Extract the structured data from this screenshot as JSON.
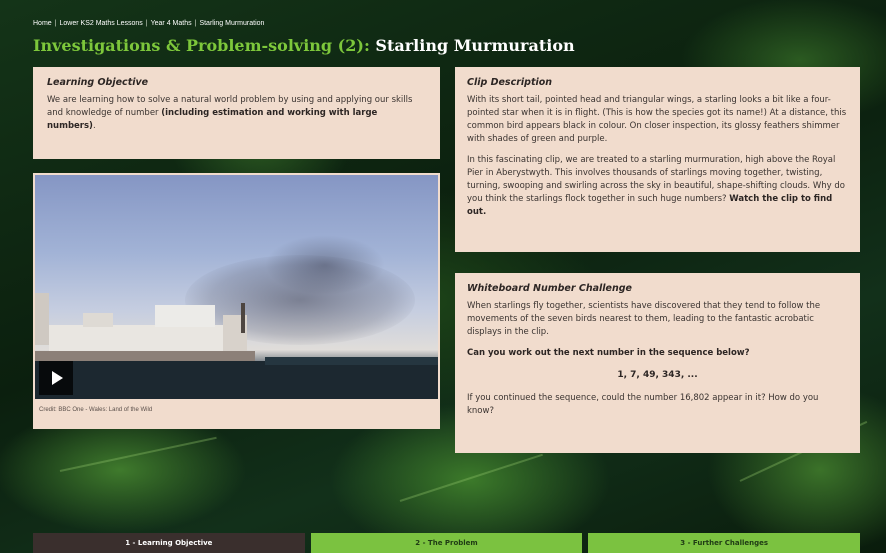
{
  "breadcrumb": [
    "Home",
    "Lower KS2 Maths Lessons",
    "Year 4 Maths",
    "Starling Murmuration"
  ],
  "title": {
    "lead": "Investigations & Problem-solving (2):",
    "rest": "Starling Murmuration"
  },
  "objective": {
    "heading": "Learning Objective",
    "text": "We are learning how to solve a natural world problem by using and applying our skills and knowledge of number",
    "bold": "(including estimation and working with large numbers)",
    "end": "."
  },
  "video": {
    "credit": "Credit: BBC One - Wales: Land of the Wild",
    "play_icon": "play-icon"
  },
  "clip": {
    "heading": "Clip Description",
    "para1": "With its short tail, pointed head and triangular wings, a starling looks a bit like a four-pointed star when it is in flight. (This is how the species got its name!) At a distance, this common bird appears black in colour. On closer inspection, its glossy feathers shimmer with shades of green and purple.",
    "para2": "In this fascinating clip, we are treated to a starling murmuration, high above the Royal Pier in Aberystwyth. This involves thousands of starlings moving together, twisting, turning, swooping and swirling across the sky in beautiful, shape-shifting clouds. Why do you think the starlings flock together in such huge numbers?",
    "para2_bold": "Watch the clip to find out."
  },
  "challenge": {
    "heading": "Whiteboard Number Challenge",
    "para1": "When starlings fly together, scientists have discovered that they tend to follow the movements of the seven birds nearest to them, leading to the fantastic acrobatic displays in the clip.",
    "question": "Can you work out the next number in the sequence below?",
    "sequence": "1, 7, 49, 343, ...",
    "para2": "If you continued the sequence, could the number 16,802 appear in it? How do you know?"
  },
  "tabs": [
    {
      "label": "1 - Learning Objective",
      "active": true
    },
    {
      "label": "2 - The Problem",
      "active": false
    },
    {
      "label": "3 - Further Challenges",
      "active": false
    }
  ],
  "colors": {
    "accent_green": "#7bc240",
    "title_green": "#7dc73b",
    "panel_bg": "#f1dccd",
    "active_tab": "#3a2f2d"
  }
}
